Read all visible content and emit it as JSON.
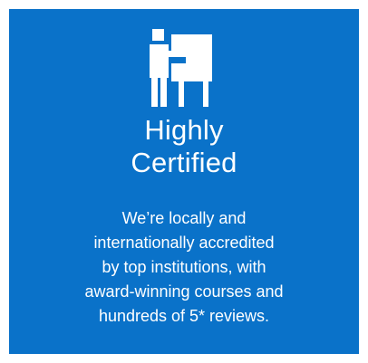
{
  "card": {
    "icon": "presenter-board-icon",
    "title": "Highly\nCertified",
    "description": "We’re locally and\ninternationally accredited\nby top institutions, with\naward-winning courses and\nhundreds of 5* reviews.",
    "background_color": "#0a72c9",
    "text_color": "#ffffff"
  }
}
